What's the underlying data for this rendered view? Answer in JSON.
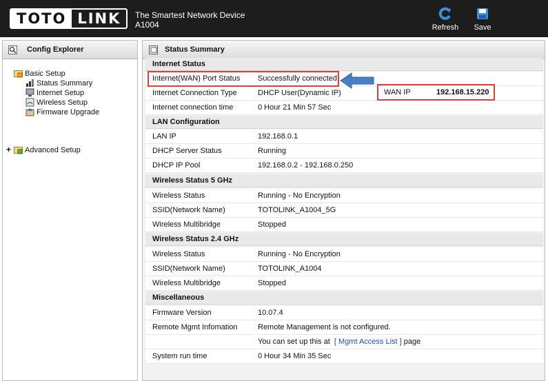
{
  "header": {
    "logo_left": "TOTO",
    "logo_right": "LINK",
    "tagline": "The Smartest Network Device",
    "model": "A1004",
    "refresh_label": "Refresh",
    "save_label": "Save",
    "refresh_icon": "refresh-icon",
    "save_icon": "save-icon"
  },
  "sidebar": {
    "title": "Config Explorer",
    "basic_setup": "Basic Setup",
    "items": [
      "Status Summary",
      "Internet Setup",
      "Wireless Setup",
      "Firmware Upgrade"
    ],
    "advanced_setup": "Advanced Setup",
    "expander": "+"
  },
  "main": {
    "title": "Status Summary",
    "sections": {
      "internet": "Internet Status",
      "lan": "LAN Configuration",
      "w5": "Wireless Status 5 GHz",
      "w24": "Wireless Status 2.4 GHz",
      "misc": "Miscellaneous"
    },
    "internet_rows": [
      {
        "label": "Internet(WAN) Port Status",
        "value": "Successfully connected"
      },
      {
        "label": "Internet Connection Type",
        "value": "DHCP User(Dynamic IP)"
      },
      {
        "label": "Internet connection time",
        "value": "0 Hour 21 Min 57 Sec"
      }
    ],
    "wan_ip_label": "WAN IP",
    "wan_ip_value": "192.168.15.220",
    "lan_rows": [
      {
        "label": "LAN IP",
        "value": "192.168.0.1"
      },
      {
        "label": "DHCP Server Status",
        "value": "Running"
      },
      {
        "label": "DHCP IP Pool",
        "value": "192.168.0.2 -  192.168.0.250"
      }
    ],
    "w5_rows": [
      {
        "label": "Wireless Status",
        "value": "Running - No Encryption"
      },
      {
        "label": "SSID(Network Name)",
        "value": "TOTOLINK_A1004_5G"
      },
      {
        "label": "Wireless Multibridge",
        "value": "Stopped"
      }
    ],
    "w24_rows": [
      {
        "label": "Wireless Status",
        "value": "Running - No Encryption"
      },
      {
        "label": "SSID(Network Name)",
        "value": "TOTOLINK_A1004"
      },
      {
        "label": "Wireless Multibridge",
        "value": "Stopped"
      }
    ],
    "misc_rows": [
      {
        "label": "Firmware Version",
        "value": "10.07.4"
      },
      {
        "label": "Remote Mgmt Infomation",
        "value": "Remote Management is not configured."
      }
    ],
    "remote_hint_prefix": "You can set up this at",
    "remote_hint_link": "[ Mgmt Access List ]",
    "remote_hint_suffix": "page",
    "uptime_label": "System run time",
    "uptime_value": "0 Hour 34 Min 35 Sec"
  },
  "colors": {
    "header_bg": "#1d1d1d",
    "highlight": "#d9403a",
    "arrow": "#4a7fc8",
    "link": "#1f4fbf"
  }
}
